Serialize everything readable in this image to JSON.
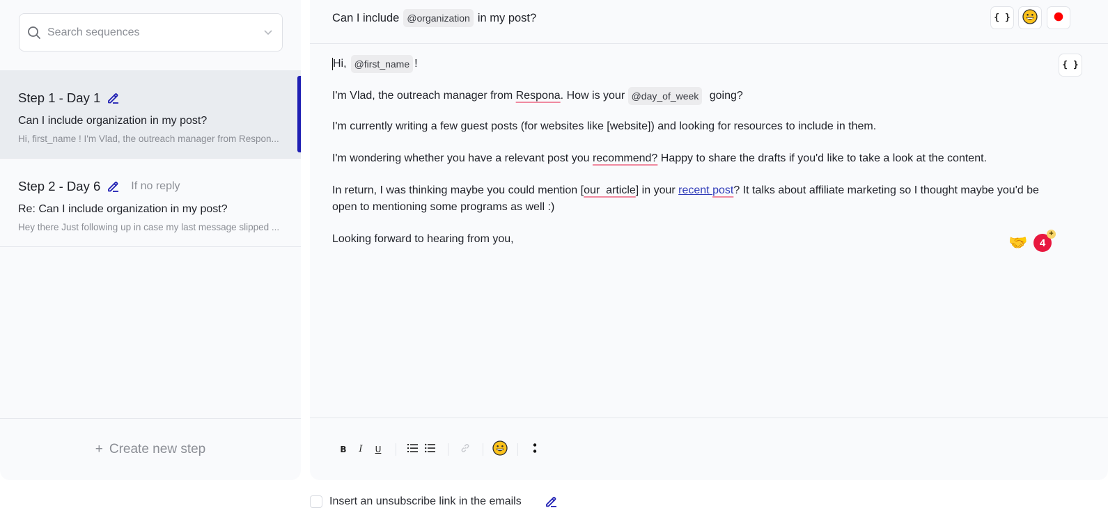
{
  "sidebar": {
    "search": {
      "placeholder": "Search sequences",
      "value": "",
      "icon": "search-icon",
      "dropdown_icon": "chevron-down-icon"
    },
    "steps": [
      {
        "title": "Step 1 - Day 1",
        "condition": "",
        "subject": "Can I include organization in my post?",
        "preview": "Hi, first_name ! I'm Vlad, the outreach manager from Respon...",
        "active": true,
        "edit_icon": "pencil-icon"
      },
      {
        "title": "Step 2 - Day 6",
        "condition": "If no reply",
        "subject": "Re: Can I include organization in my post?",
        "preview": "Hey there Just following up in case my last message slipped ...",
        "active": false,
        "edit_icon": "pencil-icon"
      }
    ],
    "create_step": {
      "icon": "+",
      "label": "Create new step"
    }
  },
  "editor": {
    "subject": {
      "before": "Can I include",
      "variable": "@organization",
      "after": "in my post?"
    },
    "subject_actions": [
      {
        "name": "variables",
        "glyph": "{ }"
      },
      {
        "name": "emoji",
        "glyph": "😀"
      },
      {
        "name": "record",
        "color": "#ff0000"
      }
    ],
    "body_variables_button": "{ }",
    "body": {
      "greeting_before": "Hi,",
      "greeting_variable": "@first_name",
      "greeting_after": "!",
      "p2_a": "I'm Vlad, the outreach manager from ",
      "p2_spell": "Respona",
      "p2_b": ". How is your ",
      "p2_variable": "@day_of_week",
      "p2_c": " going?",
      "p3": "I'm currently writing a few guest posts (for websites like [website]) and looking for resources to include in them.",
      "p4_a": "I'm wondering whether you have a relevant post you ",
      "p4_spell": "recommend?",
      "p4_b": " Happy to share the drafts if you'd like to take a look at the content.",
      "p5_a": "In return, I was thinking maybe you could mention [",
      "p5_spell": "our  article",
      "p5_b": "] in your ",
      "p5_link1": "recent ",
      "p5_link2": "post",
      "p5_c": "? It talks about affiliate marketing so I thought maybe you'd be open to mentioning some programs as well :)",
      "p6": "Looking forward to hearing from you,"
    },
    "reactions": {
      "emoji": "🤝",
      "count": "4",
      "add": "+"
    },
    "toolbar": {
      "bold": "B",
      "italic": "I",
      "underline": "U",
      "ordered_list": "ordered-list",
      "bullet_list": "bullet-list",
      "link": "link",
      "emoji": "😀",
      "more": "more"
    }
  },
  "footer": {
    "unsubscribe_label": "Insert an unsubscribe link in the emails",
    "unsubscribe_checked": false
  },
  "colors": {
    "accent": "#1f1fb3",
    "spell_underline": "#f08aa0",
    "link": "#2f3bb8",
    "badge": "#e8183f",
    "record": "#ff0000"
  }
}
